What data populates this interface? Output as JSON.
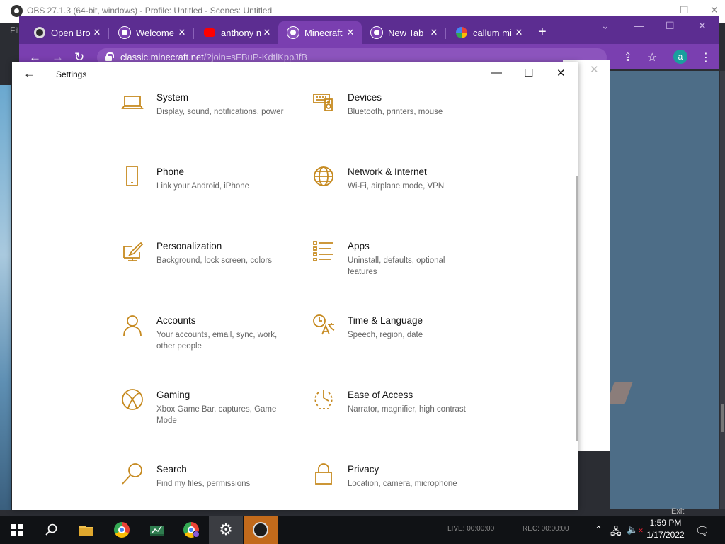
{
  "obs": {
    "title": "OBS 27.1.3 (64-bit, windows) - Profile: Untitled - Scenes: Untitled",
    "menu_file": "Fil",
    "status_live": "LIVE: 00:00:00",
    "status_rec": "REC: 00:00:00",
    "exit_label": "Exit"
  },
  "chrome": {
    "tabs": [
      {
        "title": "Open Broadcaster",
        "favicon": "obs-icon"
      },
      {
        "title": "Welcome |",
        "favicon": "chrome-icon"
      },
      {
        "title": "anthony n",
        "favicon": "youtube-icon"
      },
      {
        "title": "Minecraft",
        "favicon": "chrome-icon",
        "active": true
      },
      {
        "title": "New Tab",
        "favicon": "chrome-icon"
      },
      {
        "title": "callum mi",
        "favicon": "google-icon"
      }
    ],
    "new_tab": "+",
    "url_host": "classic.minecraft.net",
    "url_path": "/?join=sFBuP-KdtlKppJfB",
    "profile_initial": "a",
    "colors": {
      "frame": "#5c2d91",
      "active": "#7a3fb0"
    }
  },
  "settings": {
    "title": "Settings",
    "accent": "#c68a20",
    "items": [
      {
        "name": "System",
        "desc": "Display, sound, notifications, power",
        "icon": "laptop-icon"
      },
      {
        "name": "Devices",
        "desc": "Bluetooth, printers, mouse",
        "icon": "keyboard-speaker-icon"
      },
      {
        "name": "Phone",
        "desc": "Link your Android, iPhone",
        "icon": "phone-icon"
      },
      {
        "name": "Network & Internet",
        "desc": "Wi-Fi, airplane mode, VPN",
        "icon": "globe-icon"
      },
      {
        "name": "Personalization",
        "desc": "Background, lock screen, colors",
        "icon": "brush-icon"
      },
      {
        "name": "Apps",
        "desc": "Uninstall, defaults, optional features",
        "icon": "apps-list-icon"
      },
      {
        "name": "Accounts",
        "desc": "Your accounts, email, sync, work, other people",
        "icon": "person-icon"
      },
      {
        "name": "Time & Language",
        "desc": "Speech, region, date",
        "icon": "time-language-icon"
      },
      {
        "name": "Gaming",
        "desc": "Xbox Game Bar, captures, Game Mode",
        "icon": "xbox-icon"
      },
      {
        "name": "Ease of Access",
        "desc": "Narrator, magnifier, high contrast",
        "icon": "ease-of-access-icon"
      },
      {
        "name": "Search",
        "desc": "Find my files, permissions",
        "icon": "search-icon"
      },
      {
        "name": "Privacy",
        "desc": "Location, camera, microphone",
        "icon": "lock-icon"
      }
    ]
  },
  "taskbar": {
    "time": "1:59 PM",
    "date": "1/17/2022"
  }
}
